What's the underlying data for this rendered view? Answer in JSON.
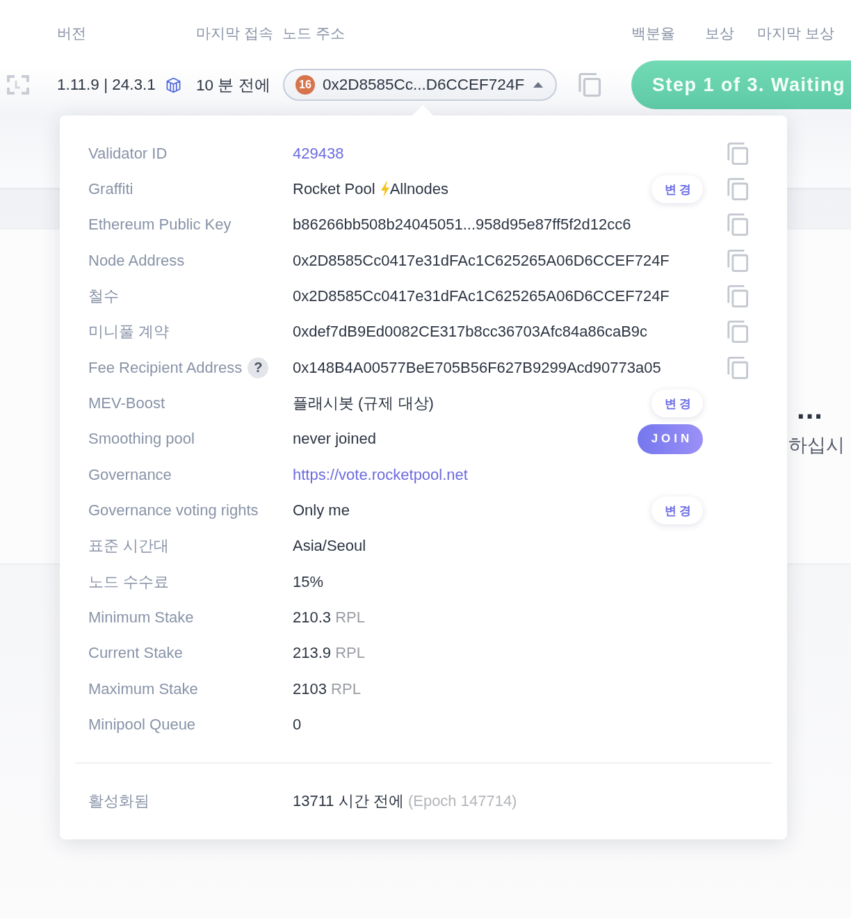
{
  "header": {
    "columns": [
      {
        "label": "버전"
      },
      {
        "label": "마지막 접속"
      },
      {
        "label": "노드 주소"
      },
      {
        "label": "백분율"
      },
      {
        "label": "보상"
      },
      {
        "label": "마지막 보상"
      }
    ]
  },
  "node_row": {
    "version": "1.11.9 | 24.3.1",
    "last_seen": "10 분 전에",
    "node": {
      "badge": "16",
      "address": "0x2D8585Cc...D6CCEF724F",
      "expanded": true
    },
    "step_button": "Step 1 of 3. Waiting"
  },
  "background_card": {
    "heading": "...",
    "text": "하십시"
  },
  "details": {
    "rows": [
      {
        "label": "Validator ID",
        "kind": "link",
        "value": "429438",
        "copy": true
      },
      {
        "label": "Graffiti",
        "kind": "text",
        "value": "Rocket Pool",
        "value_after_icon": "Allnodes",
        "copy": true,
        "action": {
          "label": "변경",
          "kind": "change"
        }
      },
      {
        "label": "Ethereum Public Key",
        "kind": "text",
        "value": "b86266bb508b24045051...958d95e87ff5f2d12cc6",
        "copy": true
      },
      {
        "label": "Node Address",
        "kind": "text",
        "value": "0x2D8585Cc0417e31dFAc1C625265A06D6CCEF724F",
        "copy": true
      },
      {
        "label": "철수",
        "kind": "text",
        "value": "0x2D8585Cc0417e31dFAc1C625265A06D6CCEF724F",
        "copy": true
      },
      {
        "label": "미니풀 계약",
        "kind": "text",
        "value": "0xdef7dB9Ed0082CE317b8cc36703Afc84a86caB9c",
        "copy": true
      },
      {
        "label": "Fee Recipient Address",
        "help": "?",
        "kind": "text",
        "value": "0x148B4A00577BeE705B56F627B9299Acd90773a05",
        "copy": true
      },
      {
        "label": "MEV-Boost",
        "kind": "text",
        "value": "플래시봇 (규제 대상)",
        "copy": false,
        "action": {
          "label": "변경",
          "kind": "change"
        }
      },
      {
        "label": "Smoothing pool",
        "kind": "text",
        "value": "never joined",
        "copy": false,
        "action": {
          "label": "JOIN",
          "kind": "join"
        }
      },
      {
        "label": "Governance",
        "kind": "link",
        "value": "https://vote.rocketpool.net",
        "copy": false
      },
      {
        "label": "Governance voting rights",
        "kind": "text",
        "value": "Only me",
        "copy": false,
        "action": {
          "label": "변경",
          "kind": "change"
        }
      },
      {
        "label": "표준 시간대",
        "kind": "text",
        "value": "Asia/Seoul",
        "copy": false
      },
      {
        "label": "노드 수수료",
        "kind": "text",
        "value": "15%",
        "copy": false
      },
      {
        "label": "Minimum Stake",
        "kind": "text",
        "value": "210.3",
        "unit": "RPL",
        "copy": false
      },
      {
        "label": "Current Stake",
        "kind": "text",
        "value": "213.9",
        "unit": "RPL",
        "copy": false
      },
      {
        "label": "Maximum Stake",
        "kind": "text",
        "value": "2103",
        "unit": "RPL",
        "copy": false
      },
      {
        "label": "Minipool Queue",
        "kind": "text",
        "value": "0",
        "copy": false
      }
    ],
    "footer": {
      "label": "활성화됨",
      "value": "13711 시간 전에",
      "note": "(Epoch 147714)"
    }
  }
}
